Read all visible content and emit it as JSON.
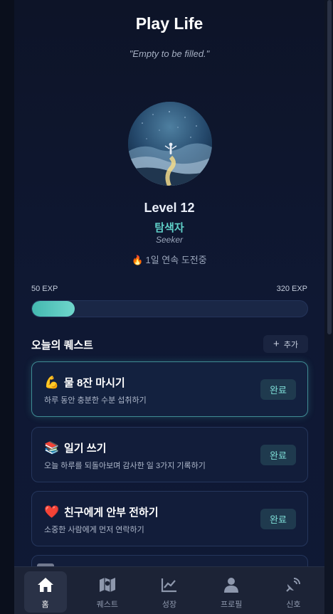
{
  "app": {
    "title": "Play Life",
    "quote": "\"Empty to be filled.\""
  },
  "profile": {
    "level": "Level 12",
    "rank": "탐색자",
    "rank_en": "Seeker",
    "streak_icon": "fire-icon",
    "streak": "1일 연속 도전중"
  },
  "exp": {
    "current": "50 EXP",
    "max": "320 EXP",
    "progress": 0.156
  },
  "quests": {
    "title": "오늘의 퀘스트",
    "add_label": "추가",
    "items": [
      {
        "emoji": "💪",
        "title": "물 8잔 마시기",
        "desc": "하루 동안 충분한 수분 섭취하기",
        "done_label": "완료"
      },
      {
        "emoji": "📚",
        "title": "일기 쓰기",
        "desc": "오늘 하루를 되돌아보며 감사한 일 3가지 기록하기",
        "done_label": "완료"
      },
      {
        "emoji": "❤️",
        "title": "친구에게 안부 전하기",
        "desc": "소중한 사람에게 먼저 연락하기",
        "done_label": "완료"
      }
    ]
  },
  "nav": {
    "items": [
      {
        "label": "홈",
        "icon": "home-icon"
      },
      {
        "label": "퀘스트",
        "icon": "map-icon"
      },
      {
        "label": "성장",
        "icon": "chart-line-icon"
      },
      {
        "label": "프로필",
        "icon": "user-icon"
      },
      {
        "label": "신호",
        "icon": "satellite-icon"
      }
    ]
  },
  "colors": {
    "accent": "#5fd0c8",
    "background": "#0f1833",
    "card": "#121d3a"
  }
}
